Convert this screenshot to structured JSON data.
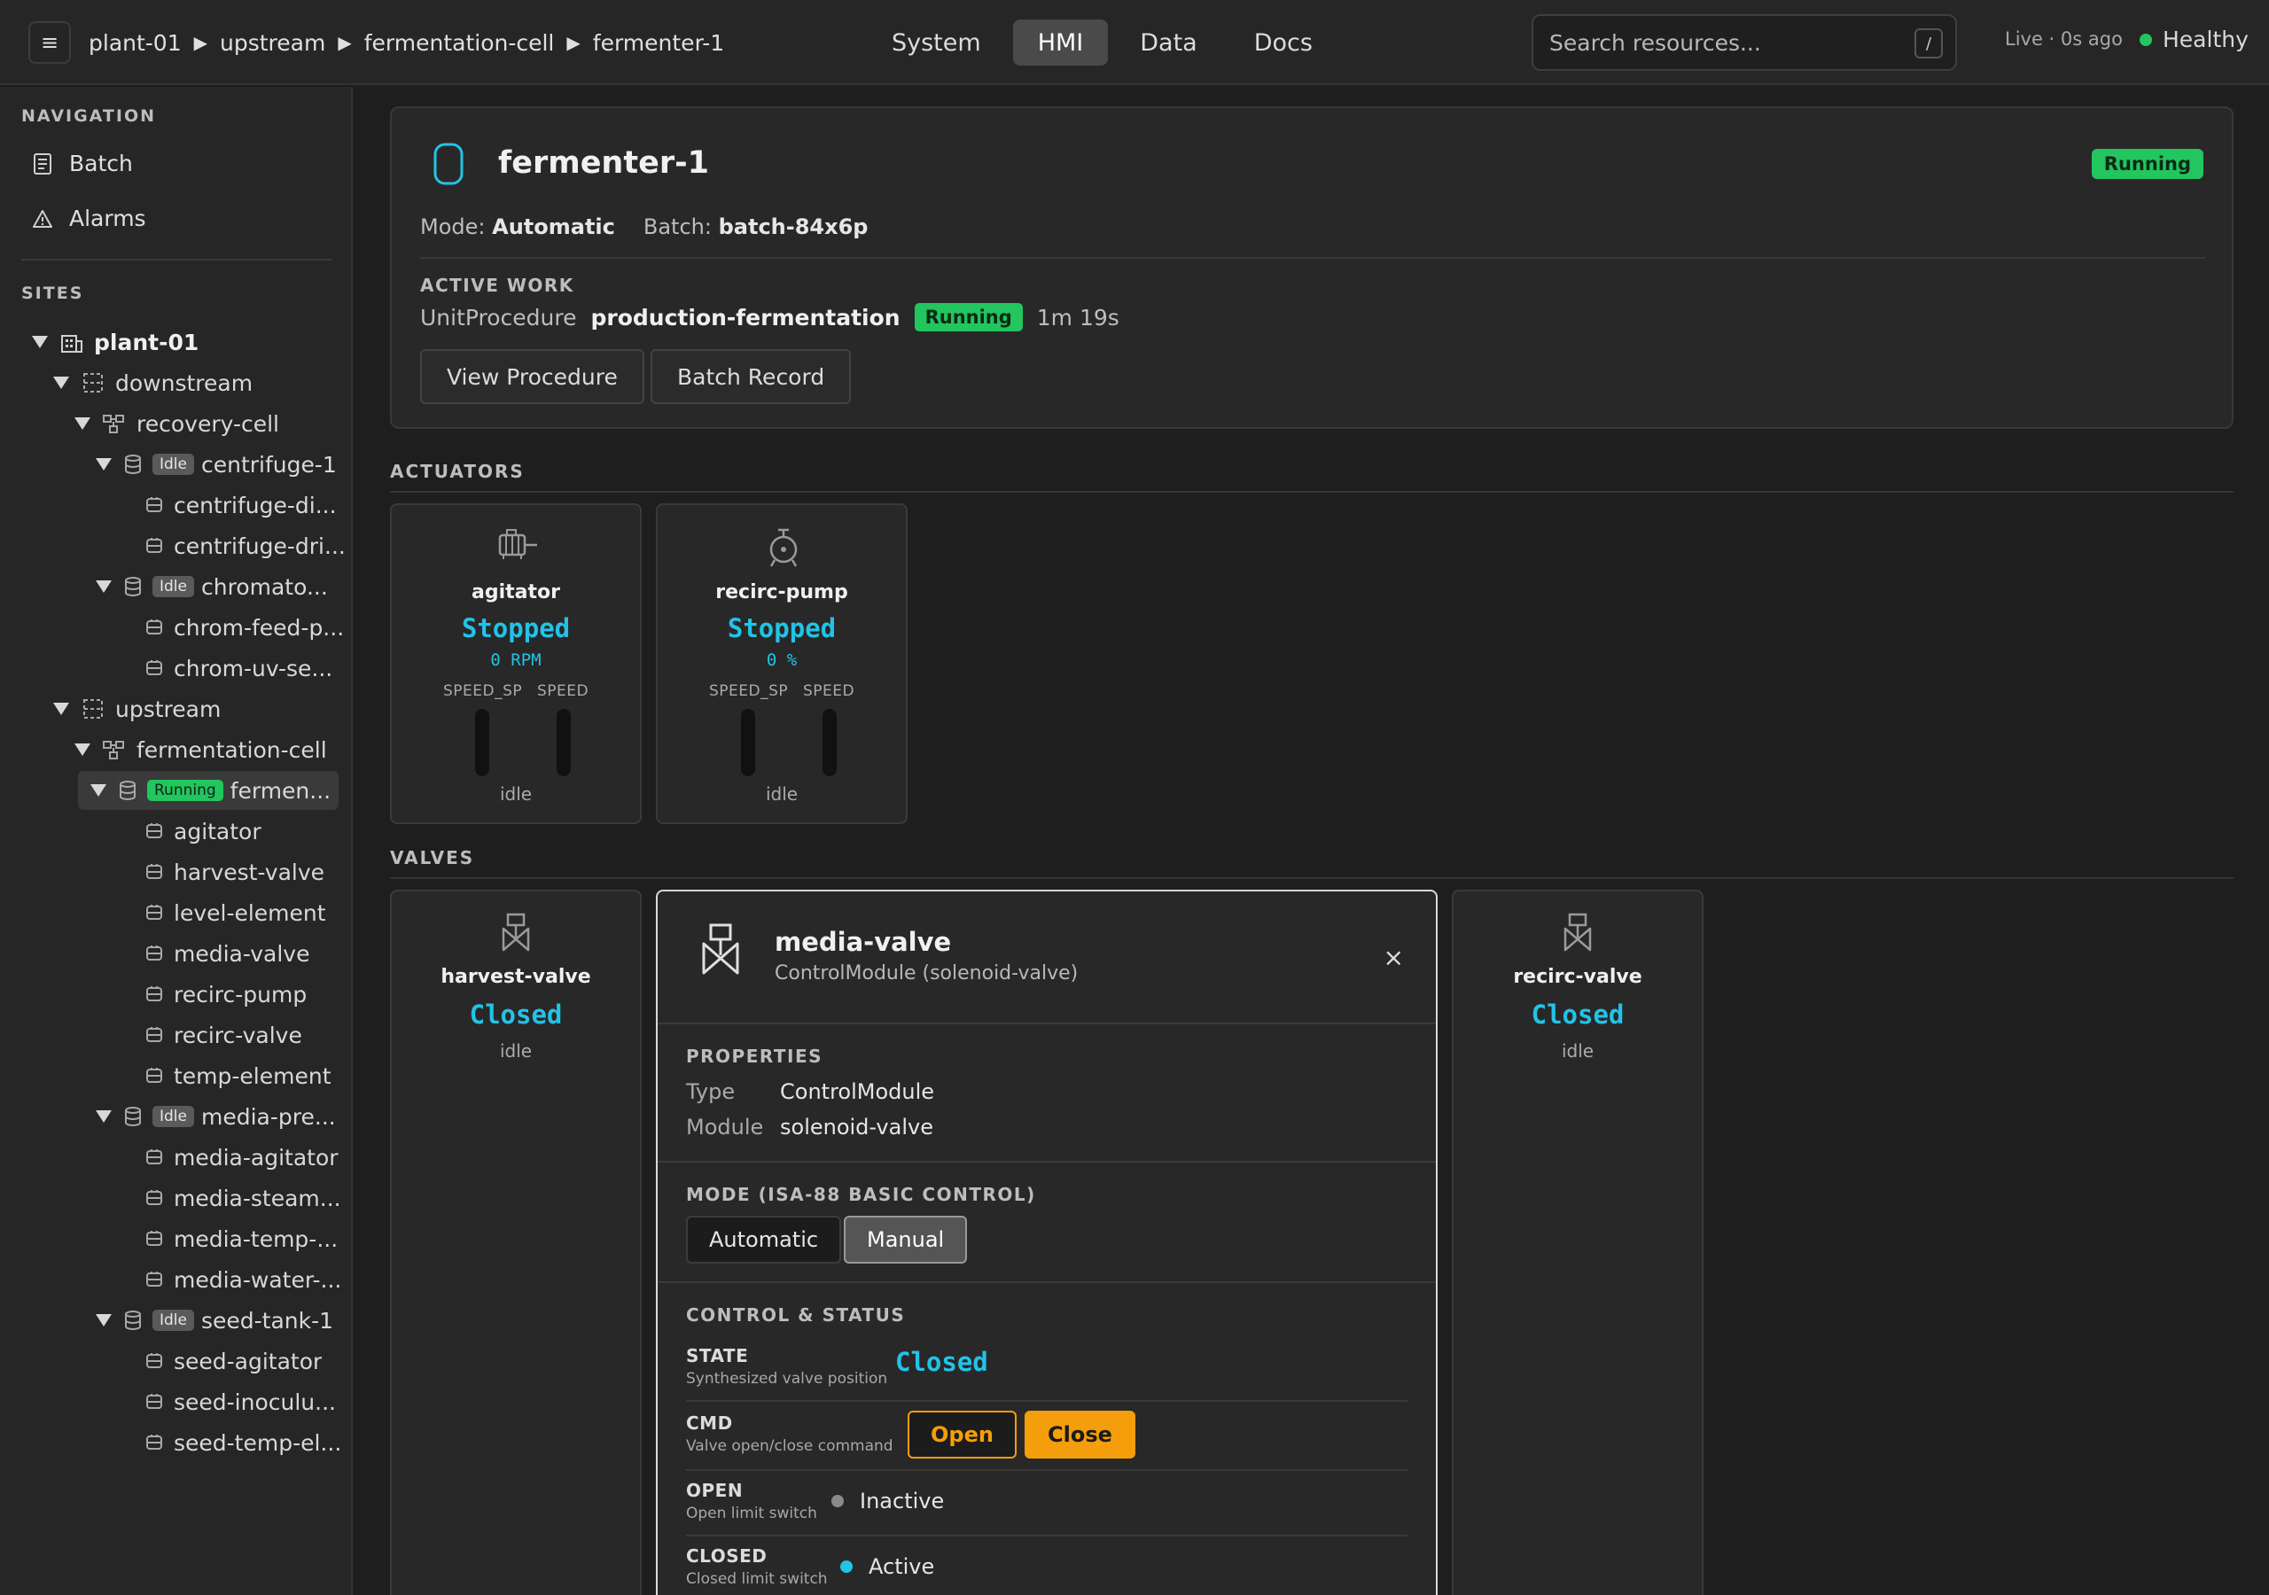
{
  "topbar": {
    "menu_glyph": "≡",
    "breadcrumb": [
      "plant-01",
      "upstream",
      "fermentation-cell",
      "fermenter-1"
    ],
    "tabs": [
      "System",
      "HMI",
      "Data",
      "Docs"
    ],
    "active_tab": "HMI",
    "search_placeholder": "Search resources...",
    "search_shortcut": "/",
    "live_status": "Live · 0s ago",
    "health": "Healthy",
    "health_color": "#22c55e"
  },
  "sidebar": {
    "nav_heading": "NAVIGATION",
    "nav_items": [
      {
        "label": "Batch",
        "icon": "document-icon"
      },
      {
        "label": "Alarms",
        "icon": "warning-icon"
      }
    ],
    "sites_heading": "SITES",
    "tree": [
      {
        "label": "plant-01",
        "icon": "site-icon",
        "caret": true,
        "bold": true
      },
      {
        "label": "downstream",
        "icon": "area-icon",
        "caret": true
      },
      {
        "label": "recovery-cell",
        "icon": "cell-icon",
        "caret": true
      },
      {
        "label": "centrifuge-1",
        "icon": "unit-icon",
        "caret": true,
        "badge": "Idle"
      },
      {
        "label": "centrifuge-di...",
        "icon": "module-icon"
      },
      {
        "label": "centrifuge-dri...",
        "icon": "module-icon"
      },
      {
        "label": "chromato...",
        "icon": "unit-icon",
        "caret": true,
        "badge": "Idle"
      },
      {
        "label": "chrom-feed-p...",
        "icon": "module-icon"
      },
      {
        "label": "chrom-uv-se...",
        "icon": "module-icon"
      },
      {
        "label": "upstream",
        "icon": "area-icon",
        "caret": true
      },
      {
        "label": "fermentation-cell",
        "icon": "cell-icon",
        "caret": true
      },
      {
        "label": "fermen...",
        "icon": "unit-icon",
        "caret": true,
        "badge": "Running",
        "selected": true
      },
      {
        "label": "agitator",
        "icon": "module-icon"
      },
      {
        "label": "harvest-valve",
        "icon": "module-icon"
      },
      {
        "label": "level-element",
        "icon": "module-icon"
      },
      {
        "label": "media-valve",
        "icon": "module-icon"
      },
      {
        "label": "recirc-pump",
        "icon": "module-icon"
      },
      {
        "label": "recirc-valve",
        "icon": "module-icon"
      },
      {
        "label": "temp-element",
        "icon": "module-icon"
      },
      {
        "label": "media-pre...",
        "icon": "unit-icon",
        "caret": true,
        "badge": "Idle"
      },
      {
        "label": "media-agitator",
        "icon": "module-icon"
      },
      {
        "label": "media-steam...",
        "icon": "module-icon"
      },
      {
        "label": "media-temp-...",
        "icon": "module-icon"
      },
      {
        "label": "media-water-...",
        "icon": "module-icon"
      },
      {
        "label": "seed-tank-1",
        "icon": "unit-icon",
        "caret": true,
        "badge": "Idle"
      },
      {
        "label": "seed-agitator",
        "icon": "module-icon"
      },
      {
        "label": "seed-inoculu...",
        "icon": "module-icon"
      },
      {
        "label": "seed-temp-el...",
        "icon": "module-icon"
      }
    ]
  },
  "unit": {
    "title": "fermenter-1",
    "status": "Running",
    "mode_label": "Mode:",
    "mode_value": "Automatic",
    "batch_label": "Batch:",
    "batch_value": "batch-84x6p",
    "active_work_heading": "ACTIVE WORK",
    "procedure_type": "UnitProcedure",
    "procedure_name": "production-fermentation",
    "procedure_status": "Running",
    "procedure_duration": "1m 19s",
    "btn_view_procedure": "View Procedure",
    "btn_batch_record": "Batch Record"
  },
  "actuators_heading": "ACTUATORS",
  "actuators": [
    {
      "name": "agitator",
      "icon": "motor-icon",
      "state": "Stopped",
      "value": "0 RPM",
      "bar_labels": [
        "SPEED_SP",
        "SPEED"
      ],
      "bar_levels": [
        0,
        0
      ],
      "status": "idle"
    },
    {
      "name": "recirc-pump",
      "icon": "pump-icon",
      "state": "Stopped",
      "value": "0 %",
      "bar_labels": [
        "SPEED_SP",
        "SPEED"
      ],
      "bar_levels": [
        0,
        0
      ],
      "status": "idle"
    }
  ],
  "valves_heading": "VALVES",
  "valves": [
    {
      "name": "harvest-valve",
      "state": "Closed",
      "status": "idle"
    },
    {
      "name": "recirc-valve",
      "state": "Closed",
      "status": "idle"
    }
  ],
  "detail": {
    "title": "media-valve",
    "subtitle": "ControlModule (solenoid-valve)",
    "close_glyph": "×",
    "properties_heading": "PROPERTIES",
    "properties": [
      {
        "key": "Type",
        "value": "ControlModule"
      },
      {
        "key": "Module",
        "value": "solenoid-valve"
      }
    ],
    "mode_heading": "MODE (ISA-88 BASIC CONTROL)",
    "mode_options": [
      "Automatic",
      "Manual"
    ],
    "mode_selected": "Manual",
    "control_heading": "CONTROL & STATUS",
    "state_key": "STATE",
    "state_desc": "Synthesized valve position",
    "state_value": "Closed",
    "cmd_key": "CMD",
    "cmd_desc": "Valve open/close command",
    "cmd_open": "Open",
    "cmd_close": "Close",
    "open_key": "OPEN",
    "open_desc": "Open limit switch",
    "open_value": "Inactive",
    "closed_key": "CLOSED",
    "closed_desc": "Closed limit switch",
    "closed_value": "Active"
  },
  "colors": {
    "accent_cyan": "#22c3e6",
    "running_green": "#22c55e",
    "cmd_amber": "#f59e0b",
    "inactive_gray": "#8a8a8a"
  }
}
